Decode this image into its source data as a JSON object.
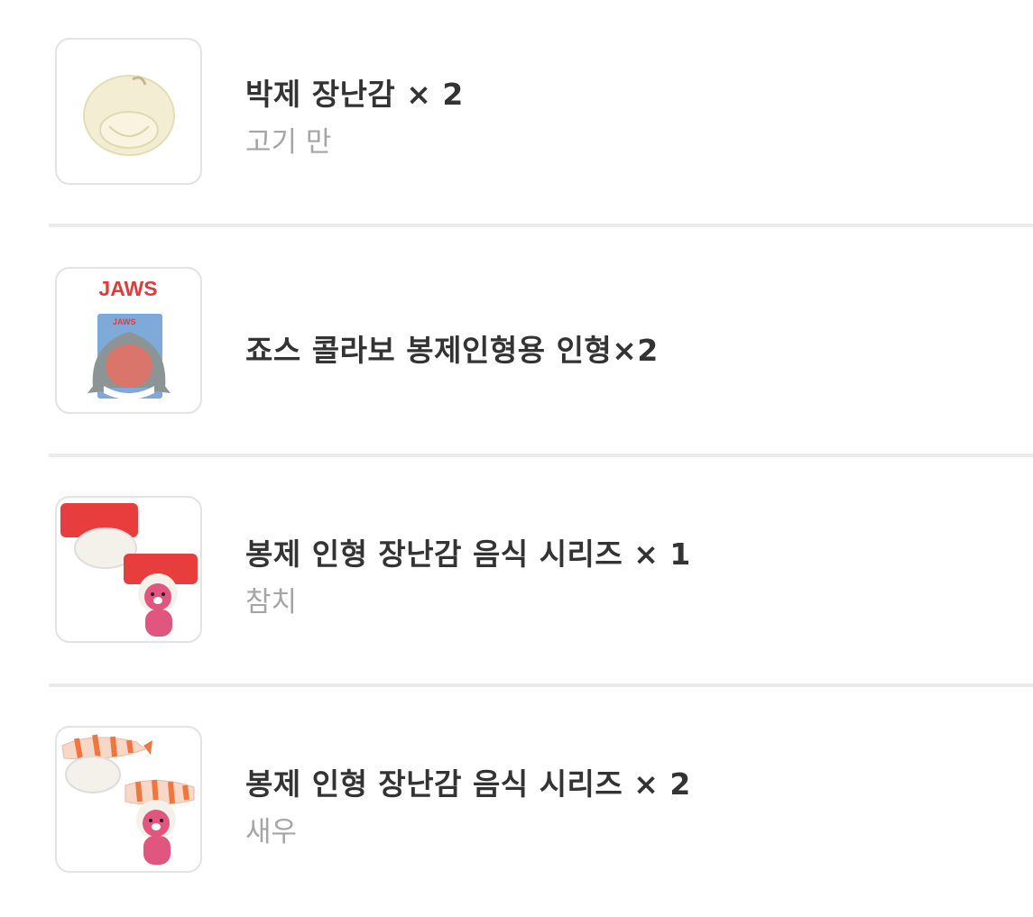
{
  "items": [
    {
      "title": "박제 장난감 × 2",
      "option": "고기 만",
      "thumbnail_icon": "dumpling-plush-icon"
    },
    {
      "title": "죠스 콜라보 봉제인형용 인형×2",
      "option": "",
      "thumbnail_icon": "shark-costume-icon",
      "thumb_brand": "JAWS",
      "thumb_pack_brand": "JAWS"
    },
    {
      "title": "봉제 인형 장난감 음식 시리즈 × 1",
      "option": "참치",
      "thumbnail_icon": "tuna-sushi-plush-icon"
    },
    {
      "title": "봉제 인형 장난감 음식 시리즈 × 2",
      "option": "새우",
      "thumbnail_icon": "shrimp-sushi-plush-icon"
    }
  ],
  "colors": {
    "title": "#333333",
    "option": "#a5a5a5",
    "divider": "#ebebeb",
    "thumb_border": "#e3e3e3",
    "jaws_red": "#e03a3a"
  }
}
